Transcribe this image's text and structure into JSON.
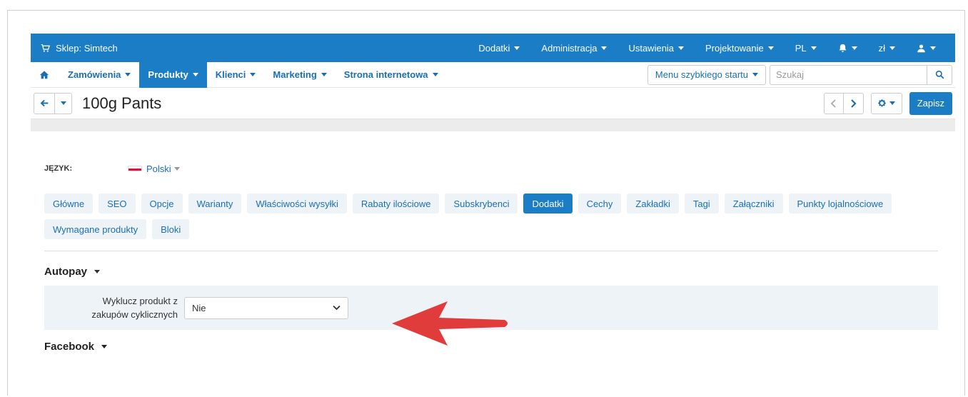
{
  "topbar": {
    "store_label": "Sklep: Simtech",
    "menu": [
      {
        "label": "Dodatki"
      },
      {
        "label": "Administracja"
      },
      {
        "label": "Ustawienia"
      },
      {
        "label": "Projektowanie"
      },
      {
        "label": "PL"
      },
      {
        "label": ""
      },
      {
        "label": "zł"
      },
      {
        "label": ""
      }
    ]
  },
  "nav": {
    "items": [
      {
        "label": "Zamówienia"
      },
      {
        "label": "Produkty"
      },
      {
        "label": "Klienci"
      },
      {
        "label": "Marketing"
      },
      {
        "label": "Strona internetowa"
      }
    ],
    "quickstart_label": "Menu szybkiego startu",
    "search_placeholder": "Szukaj"
  },
  "titlebar": {
    "title": "100g Pants",
    "save_label": "Zapisz"
  },
  "language": {
    "label": "JĘZYK:",
    "value": "Polski"
  },
  "tabs": [
    {
      "label": "Główne"
    },
    {
      "label": "SEO"
    },
    {
      "label": "Opcje"
    },
    {
      "label": "Warianty"
    },
    {
      "label": "Właściwości wysyłki"
    },
    {
      "label": "Rabaty ilościowe"
    },
    {
      "label": "Subskrybenci"
    },
    {
      "label": "Dodatki"
    },
    {
      "label": "Cechy"
    },
    {
      "label": "Zakładki"
    },
    {
      "label": "Tagi"
    },
    {
      "label": "Załączniki"
    },
    {
      "label": "Punkty lojalnościowe"
    },
    {
      "label": "Wymagane produkty"
    },
    {
      "label": "Bloki"
    }
  ],
  "active_tab": "Dodatki",
  "sections": {
    "autopay_title": "Autopay",
    "exclude_label_line1": "Wyklucz produkt z",
    "exclude_label_line2": "zakupów cyklicznych",
    "exclude_value": "Nie",
    "facebook_title": "Facebook"
  },
  "colors": {
    "primary": "#1a7dc5",
    "arrow": "#e03c3c"
  }
}
